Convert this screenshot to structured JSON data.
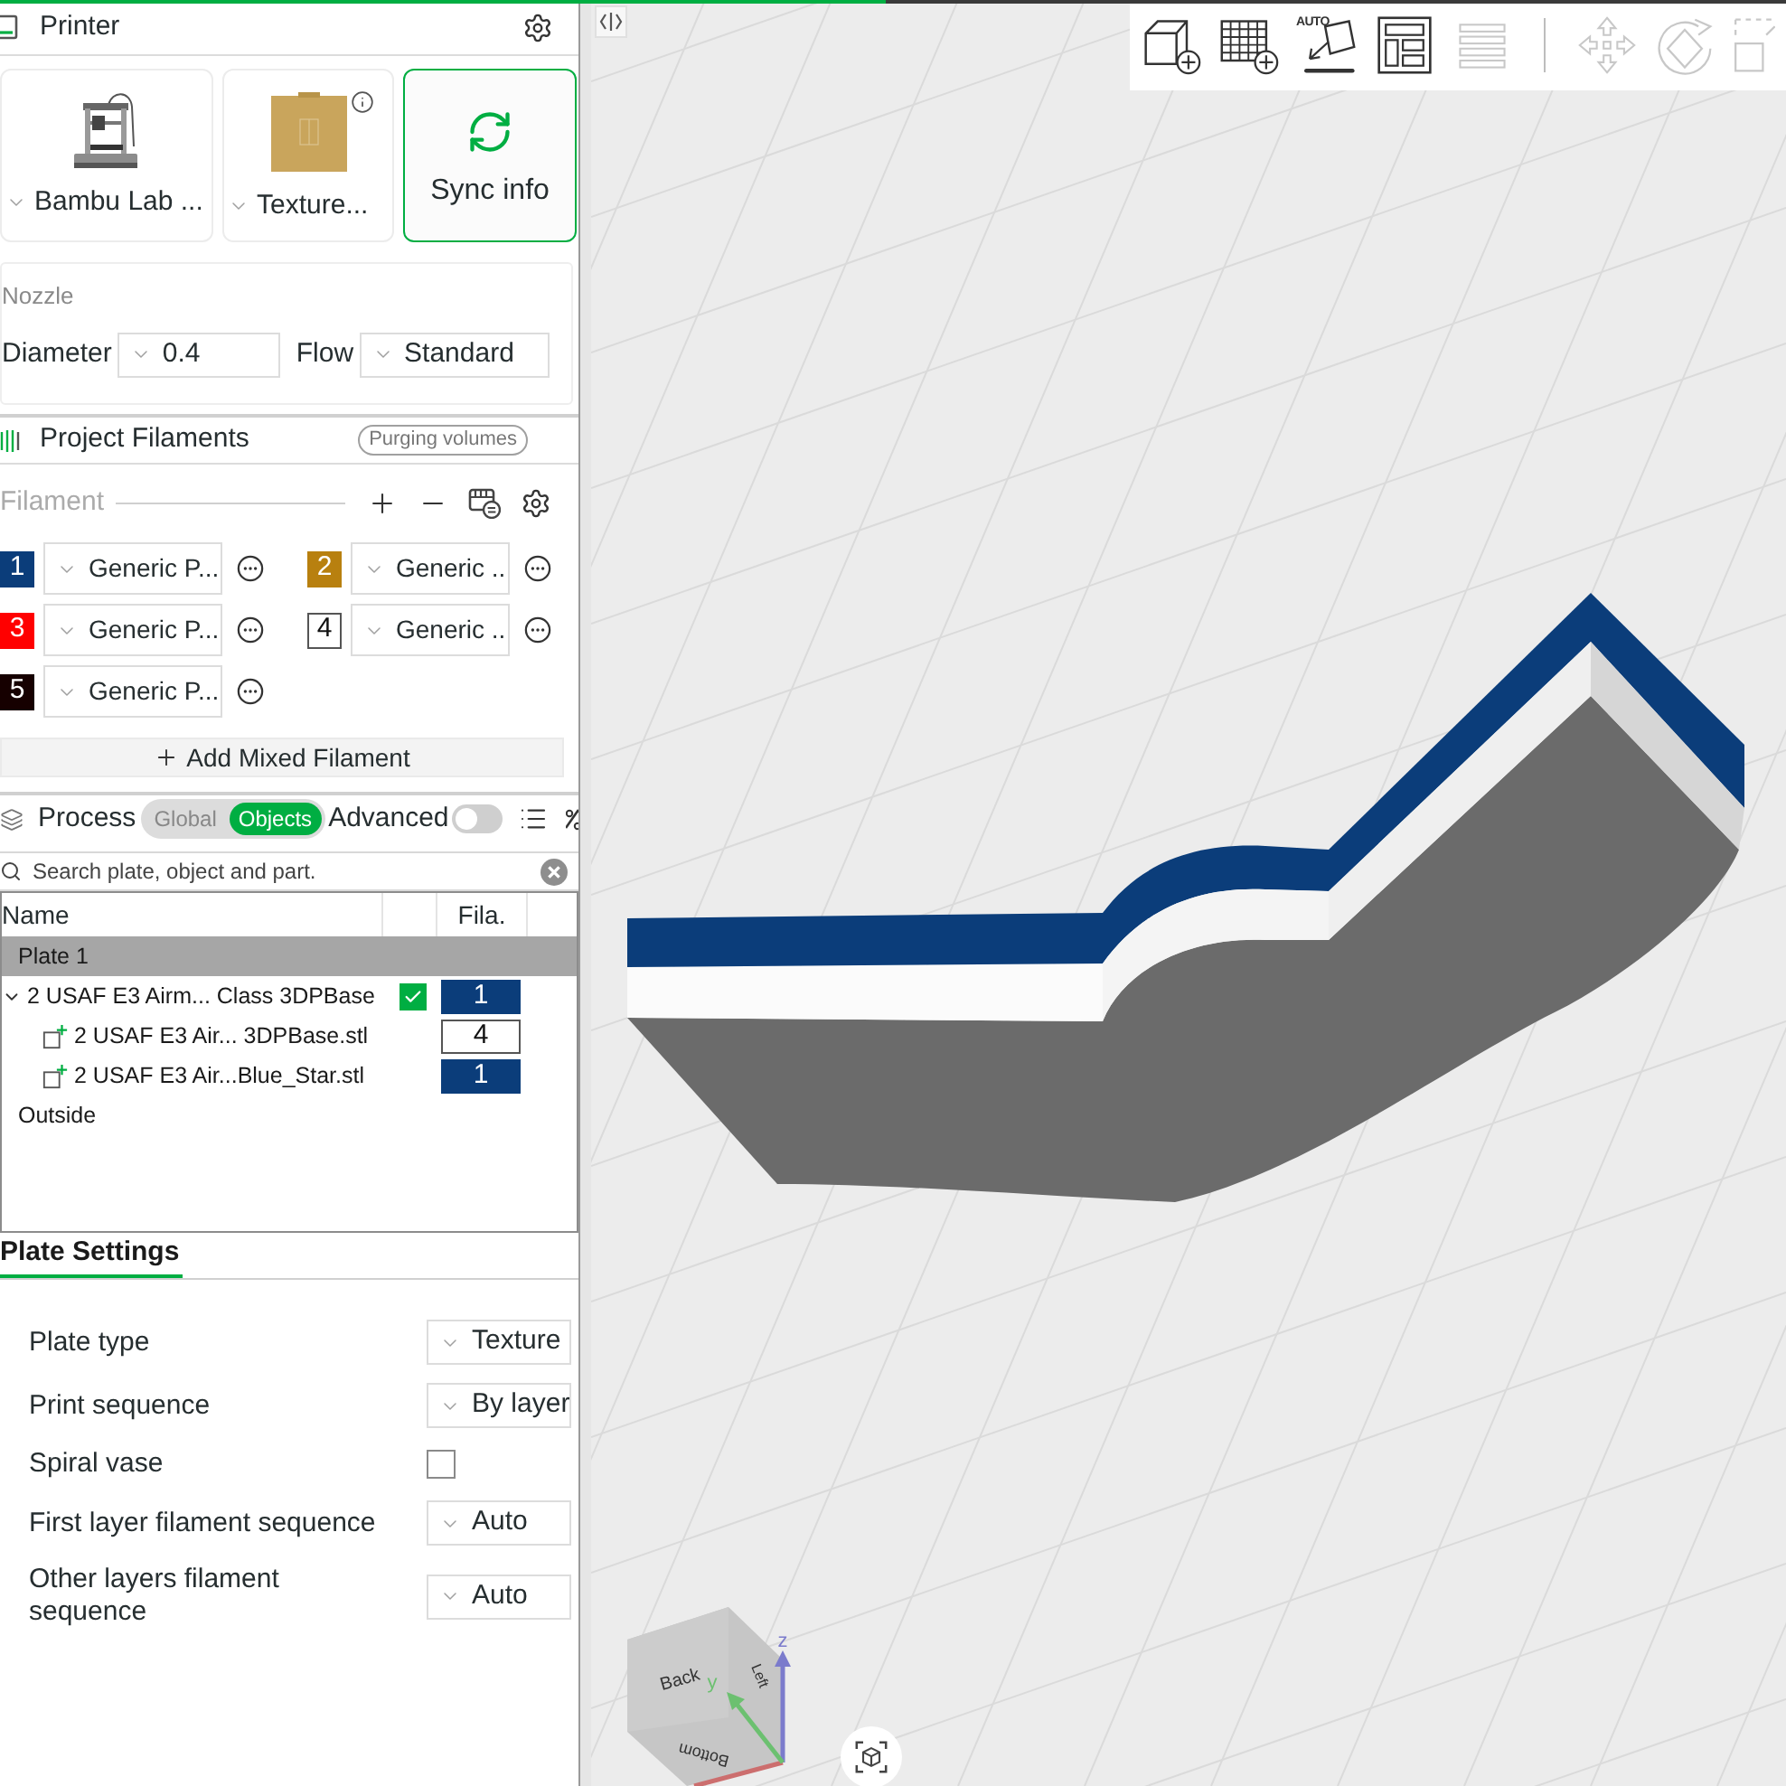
{
  "printer": {
    "title": "Printer",
    "cards": [
      {
        "kind": "printer",
        "label": "Bambu Lab ..."
      },
      {
        "kind": "plate",
        "label": "Texture..."
      }
    ],
    "sync_button": "Sync info"
  },
  "nozzle": {
    "title": "Nozzle",
    "diameter_label": "Diameter",
    "diameter": "0.4",
    "flow_label": "Flow",
    "flow": "Standard"
  },
  "filaments": {
    "title": "Project Filaments",
    "purging_button": "Purging volumes",
    "list_label": "Filament",
    "items": [
      {
        "number": "1",
        "color": "#0b3d7a",
        "name": "Generic P..."
      },
      {
        "number": "2",
        "color": "#b8800f",
        "name": "Generic ..."
      },
      {
        "number": "3",
        "color": "#ff0000",
        "name": "Generic P..."
      },
      {
        "number": "4",
        "color": "#ffffff",
        "name": "Generic ..."
      },
      {
        "number": "5",
        "color": "#160000",
        "name": "Generic P..."
      }
    ],
    "add_button": "Add Mixed Filament"
  },
  "process": {
    "title": "Process",
    "modes": [
      {
        "label": "Global",
        "selected": false
      },
      {
        "label": "Objects",
        "selected": true
      }
    ],
    "advanced": {
      "label": "Advanced",
      "on": false
    }
  },
  "search": {
    "placeholder": "Search plate, object and part."
  },
  "objects": {
    "columns": {
      "name": "Name",
      "filament": "Fila."
    },
    "rows": [
      {
        "label": "Plate 1",
        "selected": true,
        "children": [
          {
            "label": "2 USAF E3 Airm... Class 3DPBase",
            "selected": false,
            "expanded": true,
            "checked": true,
            "filament": "1",
            "color": "#0b3d7a",
            "children": [
              {
                "label": "2 USAF E3 Air... 3DPBase.stl",
                "selected": false,
                "filament": "4",
                "color": "#ffffff"
              },
              {
                "label": "2 USAF E3 Air...Blue_Star.stl",
                "selected": false,
                "filament": "1",
                "color": "#0b3d7a"
              }
            ]
          }
        ]
      },
      {
        "label": "Outside",
        "selected": false
      }
    ]
  },
  "plate_settings": {
    "tab": {
      "label": "Plate Settings",
      "selected": true
    },
    "rows": [
      {
        "kind": "dropdown",
        "label": "Plate type",
        "value": "Texture"
      },
      {
        "kind": "dropdown",
        "label": "Print sequence",
        "value": "By layer"
      },
      {
        "kind": "checkbox",
        "label": "Spiral vase",
        "checked": false
      },
      {
        "kind": "dropdown",
        "label": "First layer filament sequence",
        "value": "Auto"
      },
      {
        "kind": "dropdown",
        "label": "Other layers filament sequence",
        "value": "Auto"
      }
    ]
  },
  "viewport": {
    "toolbar": [
      {
        "kind": "add-object",
        "disabled": false
      },
      {
        "kind": "add-plate",
        "disabled": false
      },
      {
        "kind": "auto-orient",
        "label": "AUTO",
        "disabled": false
      },
      {
        "kind": "arrange",
        "disabled": false
      },
      {
        "kind": "layers",
        "disabled": true
      },
      {
        "kind": "separator"
      },
      {
        "kind": "move",
        "disabled": true
      },
      {
        "kind": "rotate",
        "disabled": true
      },
      {
        "kind": "scale",
        "disabled": true
      }
    ],
    "view_cube": {
      "faces": [
        "Back",
        "Left",
        "Bottom"
      ],
      "axes": [
        "z",
        "y"
      ]
    }
  }
}
